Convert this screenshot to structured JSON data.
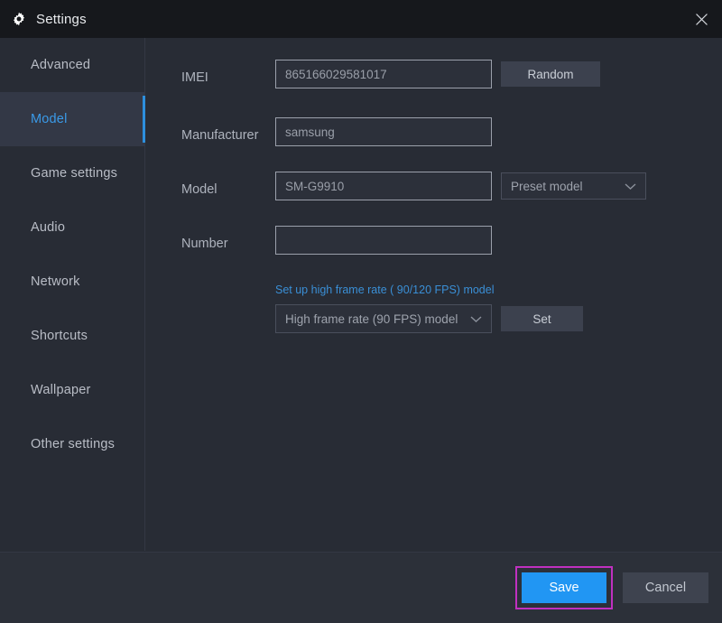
{
  "window": {
    "title": "Settings",
    "gear_icon": "gear-icon",
    "close_icon": "close-icon"
  },
  "sidebar": {
    "items": [
      {
        "label": "Advanced",
        "active": false
      },
      {
        "label": "Model",
        "active": true
      },
      {
        "label": "Game settings",
        "active": false
      },
      {
        "label": "Audio",
        "active": false
      },
      {
        "label": "Network",
        "active": false
      },
      {
        "label": "Shortcuts",
        "active": false
      },
      {
        "label": "Wallpaper",
        "active": false
      },
      {
        "label": "Other settings",
        "active": false
      }
    ]
  },
  "form": {
    "imei": {
      "label": "IMEI",
      "value": "865166029581017",
      "placeholder": "",
      "button_label": "Random"
    },
    "manufacturer": {
      "label": "Manufacturer",
      "value": "samsung",
      "placeholder": ""
    },
    "model": {
      "label": "Model",
      "value": "SM-G9910",
      "placeholder": "",
      "preset_selected": "Preset model",
      "preset_icon": "chevron-down-icon"
    },
    "number": {
      "label": "Number",
      "value": "",
      "placeholder": ""
    },
    "high_frame_rate": {
      "link_label": "Set up high frame rate ( 90/120 FPS) model",
      "selected": "High frame rate (90 FPS) model",
      "dropdown_icon": "chevron-down-icon",
      "set_button_label": "Set"
    }
  },
  "footer": {
    "save_label": "Save",
    "cancel_label": "Cancel"
  },
  "colors": {
    "accent_blue": "#2d8fdd",
    "save_blue": "#2196f3",
    "link_blue": "#3a8fd6",
    "highlight_magenta": "#c030c0",
    "window_bg": "#282c35",
    "titlebar_bg": "#16181c"
  }
}
